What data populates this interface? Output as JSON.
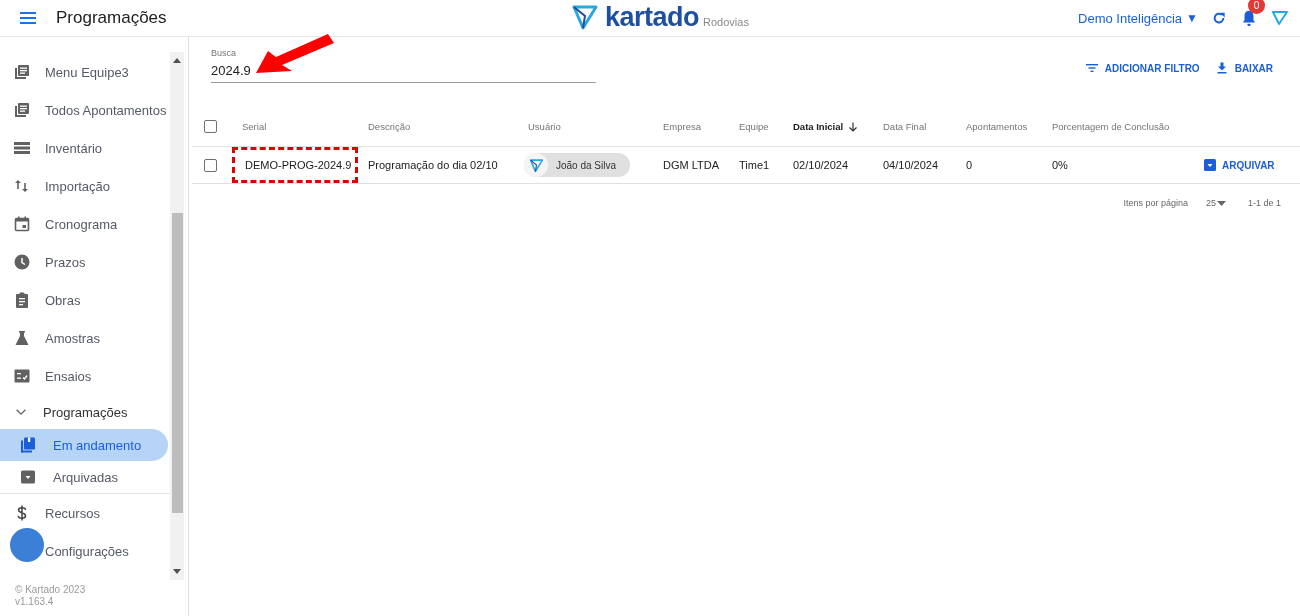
{
  "header": {
    "title": "Programações",
    "logo": {
      "name": "kartado",
      "sub": "Rodovias"
    },
    "org": "Demo Inteligência",
    "org_caret": "▼",
    "notifications": "0"
  },
  "sidebar": {
    "items": [
      {
        "label": "Menu Equipe3"
      },
      {
        "label": "Todos Apontamentos"
      },
      {
        "label": "Inventário"
      },
      {
        "label": "Importação"
      },
      {
        "label": "Cronograma"
      },
      {
        "label": "Prazos"
      },
      {
        "label": "Obras"
      },
      {
        "label": "Amostras"
      },
      {
        "label": "Ensaios"
      },
      {
        "label": "Programações",
        "expanded": true,
        "children": [
          {
            "label": "Em andamento",
            "selected": true
          },
          {
            "label": "Arquivadas",
            "selected": false
          }
        ]
      },
      {
        "label": "Recursos"
      },
      {
        "label": "Configurações"
      }
    ],
    "footer": [
      "© Kartado 2023",
      "v1.163.4"
    ]
  },
  "search": {
    "label": "Busca",
    "value": "2024.9",
    "annotated": true
  },
  "actions": [
    "ADICIONAR FILTRO",
    "BAIXAR"
  ],
  "table": {
    "all_selected": false,
    "columns": [
      {
        "label": "Serial",
        "sorted": false
      },
      {
        "label": "Descrição",
        "sorted": false
      },
      {
        "label": "Usuário",
        "sorted": false
      },
      {
        "label": "Empresa",
        "sorted": false
      },
      {
        "label": "Equipe",
        "sorted": false
      },
      {
        "label": "Data Inicial",
        "sorted": true
      },
      {
        "label": "Data Final",
        "sorted": false
      },
      {
        "label": "Apontamentos",
        "sorted": false
      },
      {
        "label": "Porcentagem de Conclusão",
        "sorted": false
      }
    ],
    "rows": [
      {
        "selected": false,
        "serial": "DEMO-PROG-2024.9",
        "serial_highlighted": true,
        "description": "Programação do dia 02/10",
        "user": "João da Silva",
        "company": "DGM LTDA",
        "team": "Time1",
        "start": "02/10/2024",
        "end": "04/10/2024",
        "entries": "0",
        "completion": "0%",
        "action": "ARQUIVAR"
      }
    ]
  },
  "pagination": {
    "label": "Itens por página",
    "size": "25",
    "range": "1-1 de 1"
  }
}
